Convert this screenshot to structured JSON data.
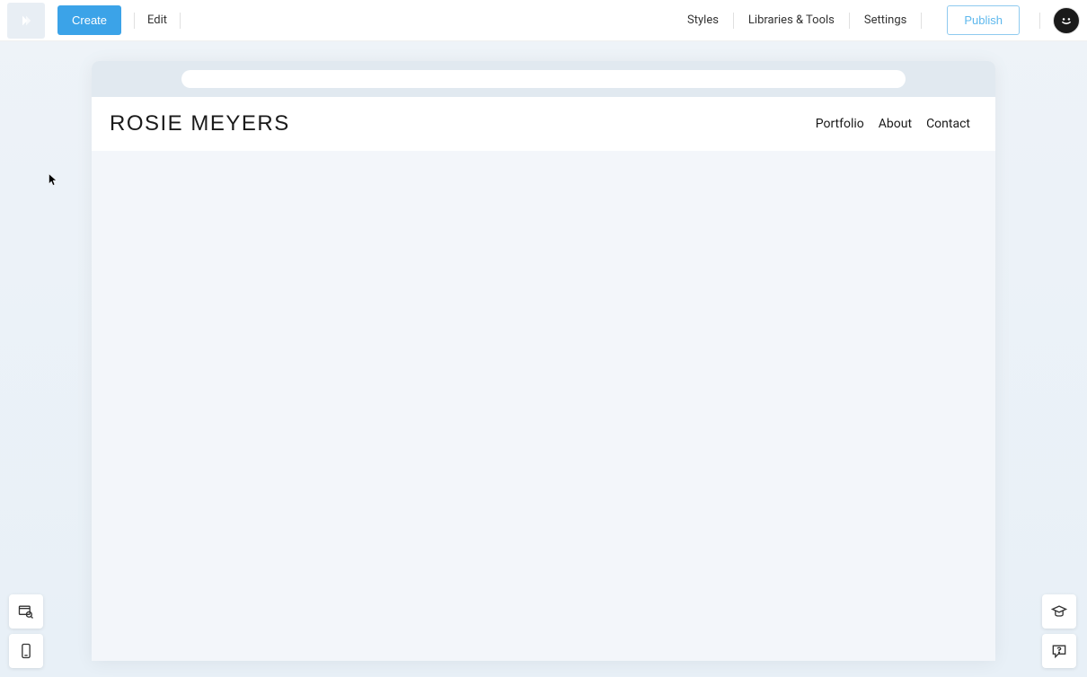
{
  "toolbar": {
    "create_label": "Create",
    "edit_label": "Edit",
    "styles_label": "Styles",
    "libraries_label": "Libraries & Tools",
    "settings_label": "Settings",
    "publish_label": "Publish"
  },
  "site": {
    "title": "ROSIE MEYERS",
    "nav": {
      "portfolio": "Portfolio",
      "about": "About",
      "contact": "Contact"
    }
  }
}
